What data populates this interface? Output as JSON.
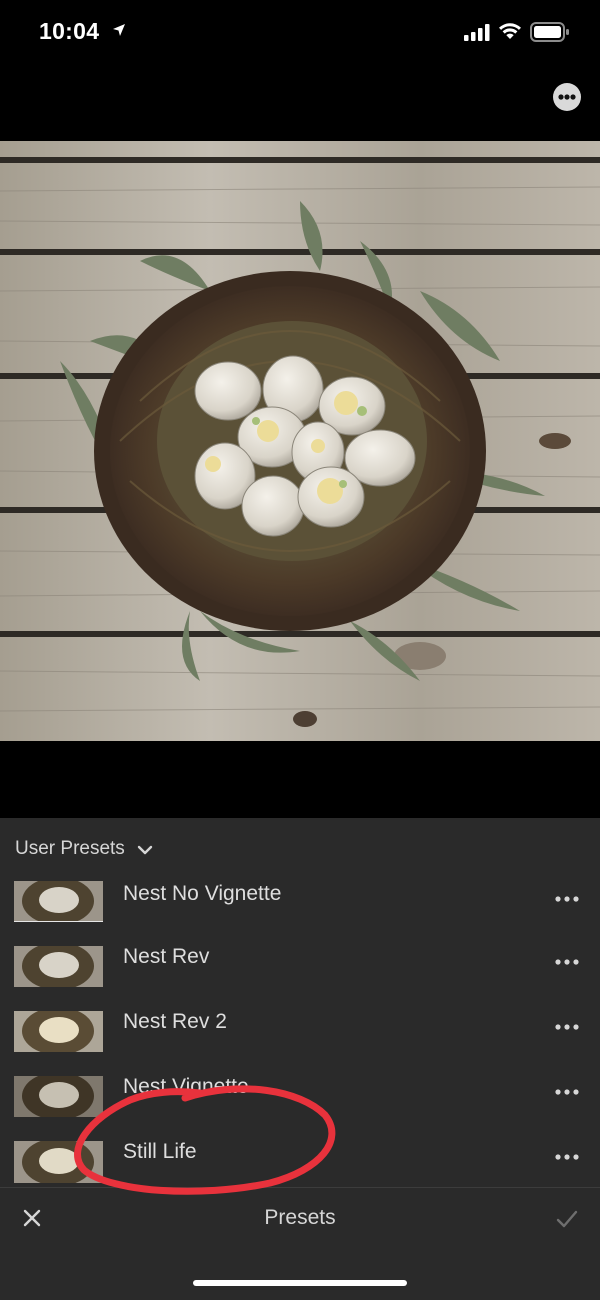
{
  "status_bar": {
    "time": "10:04",
    "icons": [
      "location-arrow-icon",
      "cellular-signal-icon",
      "wifi-icon",
      "battery-icon"
    ]
  },
  "toolbar": {
    "more_icon": "more-horizontal-icon"
  },
  "presets_panel": {
    "group_label": "User Presets",
    "group_icon": "chevron-down-icon",
    "items": [
      {
        "name": "Nest No Vignette"
      },
      {
        "name": "Nest Rev"
      },
      {
        "name": "Nest Rev 2"
      },
      {
        "name": "Nest Vignette"
      },
      {
        "name": "Still Life"
      }
    ],
    "highlighted_item": "Still Life",
    "annotation_color": "#e8323c"
  },
  "footer": {
    "title": "Presets",
    "cancel_icon": "close-icon",
    "confirm_icon": "checkmark-icon"
  },
  "colors": {
    "panel_bg": "#2a2a2a",
    "text": "#dedede"
  }
}
